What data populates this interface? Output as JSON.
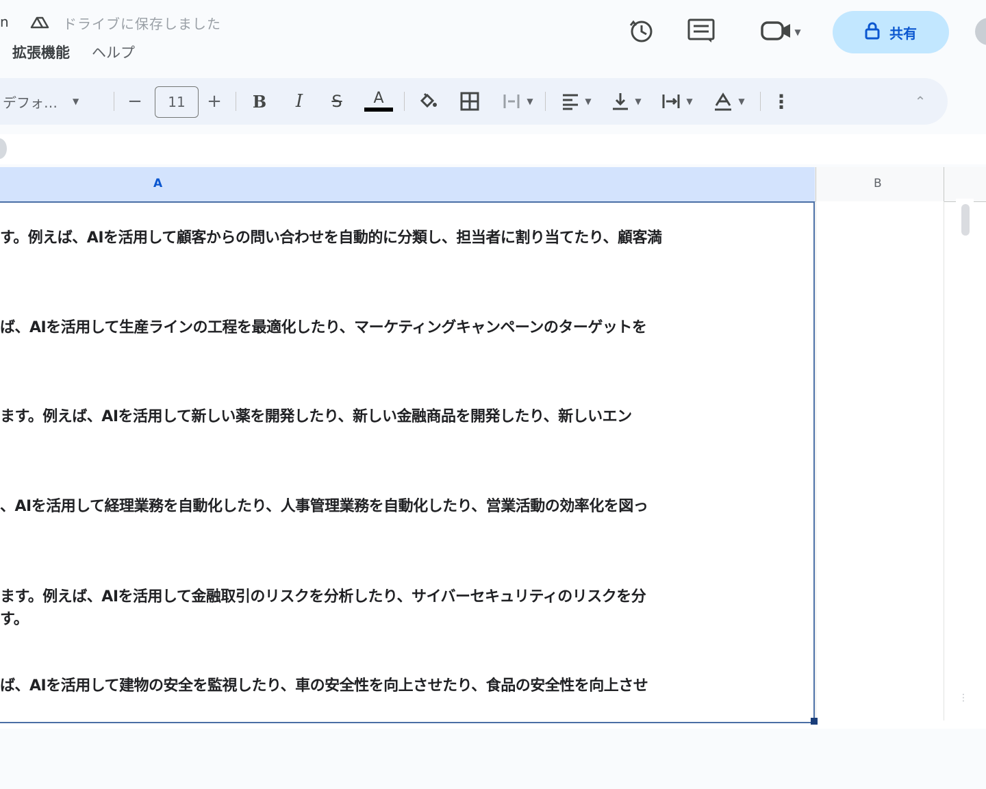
{
  "header": {
    "title_fragment": "n",
    "saved_status": "ドライブに保存しました",
    "share_label": "共有",
    "icons": [
      "history-icon",
      "comment-icon",
      "meet-icon",
      "lock-icon",
      "drive-icon"
    ]
  },
  "menu": {
    "items": [
      "拡張機能",
      "ヘルプ"
    ]
  },
  "toolbar": {
    "font_family": "デフォ…",
    "font_size": "11",
    "bold": "B",
    "italic": "I",
    "strike": "S",
    "text_color_letter": "A",
    "more": "⋮",
    "collapse": "⌃"
  },
  "grid": {
    "columns": [
      "A",
      "B"
    ],
    "selected_column": "A",
    "cell_lines": [
      "す。例えば、AIを活用して顧客からの問い合わせを自動的に分類し、担当者に割り当てたり、顧客満",
      "ば、AIを活用して生産ラインの工程を最適化したり、マーケティングキャンペーンのターゲットを",
      "ます。例えば、AIを活用して新しい薬を開発したり、新しい金融商品を開発したり、新しいエン",
      "、AIを活用して経理業務を自動化したり、人事管理業務を自動化したり、営業活動の効率化を図っ",
      "ます。例えば、AIを活用して金融取引のリスクを分析したり、サイバーセキュリティのリスクを分",
      "ば、AIを活用して建物の安全を監視したり、車の安全性を向上させたり、食品の安全性を向上させ"
    ],
    "continuation": "す。"
  },
  "colors": {
    "accent": "#0b57d0",
    "share_bg": "#c2e7ff",
    "toolbar_bg": "#edf2fa",
    "selection_header": "#d3e3fd"
  }
}
